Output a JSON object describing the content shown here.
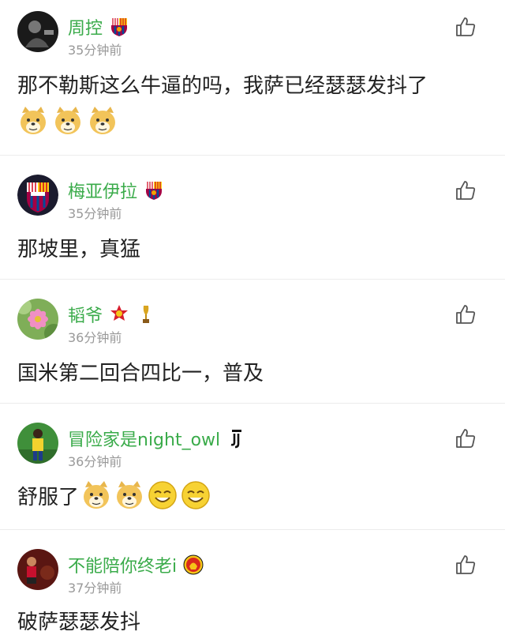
{
  "comments": [
    {
      "username": "周控",
      "time": "35分钟前",
      "text": "那不勒斯这么牛逼的吗，我萨已经瑟瑟发抖了",
      "badges": [
        "barcelona-badge"
      ],
      "emojis": [
        "doge-emoji",
        "doge-emoji",
        "doge-emoji"
      ]
    },
    {
      "username": "梅亚伊拉",
      "time": "35分钟前",
      "text": "那坡里，真猛",
      "badges": [
        "barcelona-badge"
      ],
      "emojis": []
    },
    {
      "username": "韬爷",
      "time": "36分钟前",
      "text": "国米第二回合四比一，普及",
      "badges": [
        "guangzhou-evergrande-badge",
        "trophy-badge"
      ],
      "emojis": []
    },
    {
      "username": "冒险家是night_owl",
      "time": "36分钟前",
      "text": "舒服了",
      "badges": [
        "juventus-badge"
      ],
      "emojis": [
        "doge-emoji",
        "doge-emoji",
        "smile-emoji",
        "smile-emoji"
      ]
    },
    {
      "username": "不能陪你终老i",
      "time": "37分钟前",
      "text": "破萨瑟瑟发抖",
      "badges": [
        "manchester-united-badge"
      ],
      "emojis": []
    }
  ],
  "colors": {
    "username": "#3aab4a",
    "time": "#999999",
    "text": "#222222",
    "divider": "#ececec"
  }
}
